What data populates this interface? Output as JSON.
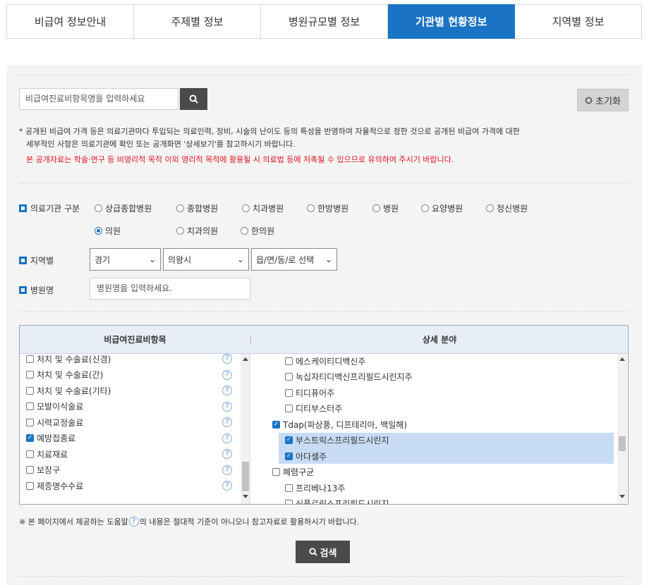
{
  "tabs": [
    {
      "label": "비급여 정보안내",
      "active": false
    },
    {
      "label": "주제별 정보",
      "active": false
    },
    {
      "label": "병원규모별 정보",
      "active": false
    },
    {
      "label": "기관별 현황정보",
      "active": true
    },
    {
      "label": "지역별 정보",
      "active": false
    }
  ],
  "search": {
    "placeholder": "비급여진료비항목명을 입력하세요",
    "icon": "search-icon"
  },
  "reset": {
    "label": "초기화",
    "icon": "refresh-icon"
  },
  "notice": {
    "line1": "* 공개된 비급여 가격 등은 의료기관마다 투입되는 의료인력, 장비, 시술의 난이도 등의 특성을 반영하여 자율적으로 정한 것으로 공개된 비급여 가격에 대한",
    "line2": "세부적인 사항은 의료기관에 확인 또는 공개화면 '상세보기'를 참고하시기 바랍니다.",
    "warning": "본 공개자료는 학술·연구 등 비영리적 목적 이외 영리적 목적에 활용될 시 의료법 등에 저촉될 수 있으므로 유의하여 주시기 바랍니다.",
    "warning_color": "#e0141e"
  },
  "filters": {
    "institution_label": "의료기관 구분",
    "institution_options": [
      {
        "label": "상급종합병원",
        "selected": false
      },
      {
        "label": "종합병원",
        "selected": false
      },
      {
        "label": "치과병원",
        "selected": false
      },
      {
        "label": "한방병원",
        "selected": false
      },
      {
        "label": "병원",
        "selected": false
      },
      {
        "label": "요양병원",
        "selected": false
      },
      {
        "label": "정신병원",
        "selected": false
      },
      {
        "label": "의원",
        "selected": true
      },
      {
        "label": "치과의원",
        "selected": false
      },
      {
        "label": "한의원",
        "selected": false
      }
    ],
    "region_label": "지역별",
    "region": {
      "province": "경기",
      "city": "의왕시",
      "town": "읍/면/동/로 선택"
    },
    "hospital_label": "병원명",
    "hospital_placeholder": "병원명을 입력하세요."
  },
  "table": {
    "left_header": "비급여진료비항목",
    "right_header": "상세 분야",
    "left_items": [
      {
        "label": "처치 및 수술료(신경)",
        "checked": false
      },
      {
        "label": "처치 및 수술료(간)",
        "checked": false
      },
      {
        "label": "처치 및 수술료(기타)",
        "checked": false
      },
      {
        "label": "모발이식술료",
        "checked": false
      },
      {
        "label": "시력교정술료",
        "checked": false
      },
      {
        "label": "예방접종료",
        "checked": true
      },
      {
        "label": "치료재료",
        "checked": false
      },
      {
        "label": "보장구",
        "checked": false
      },
      {
        "label": "제증명수수료",
        "checked": false
      }
    ],
    "right_items": [
      {
        "label": "에스케이티디백신주",
        "checked": false,
        "level": 2,
        "highlight": false
      },
      {
        "label": "녹십자티디백신프리필드시린지주",
        "checked": false,
        "level": 2,
        "highlight": false
      },
      {
        "label": "티디퓨어주",
        "checked": false,
        "level": 2,
        "highlight": false
      },
      {
        "label": "디티부스터주",
        "checked": false,
        "level": 2,
        "highlight": false
      },
      {
        "label": "Tdap(파상풍, 디프테리아, 백일해)",
        "checked": true,
        "level": 1,
        "highlight": false
      },
      {
        "label": "부스트릭스프리필드시린지",
        "checked": true,
        "level": 2,
        "highlight": true
      },
      {
        "label": "아다셀주",
        "checked": true,
        "level": 2,
        "highlight": true
      },
      {
        "label": "폐렴구균",
        "checked": false,
        "level": 1,
        "highlight": false
      },
      {
        "label": "프리베나13주",
        "checked": false,
        "level": 2,
        "highlight": false
      },
      {
        "label": "신플로릭스프리필드시린지",
        "checked": false,
        "level": 2,
        "highlight": false
      }
    ]
  },
  "help": {
    "before": "※ 본 페이지에서 제공하는 도움말",
    "after": "의 내용은 절대적 기준이 아니오니 참고자료로 활용하시기 바랍니다."
  },
  "submit": {
    "label": "검색",
    "icon": "search-icon"
  }
}
